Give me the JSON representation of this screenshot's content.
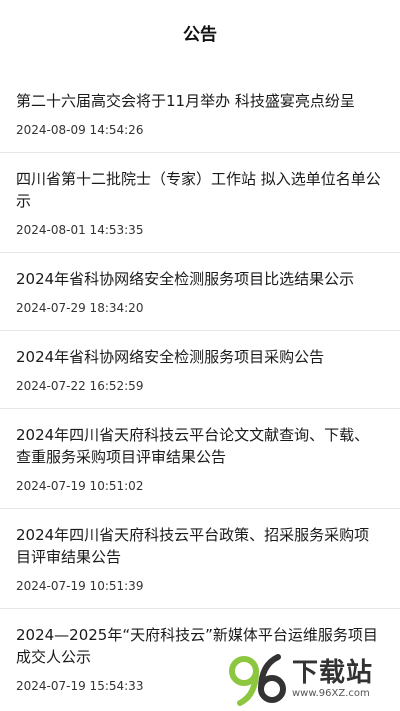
{
  "header": {
    "title": "公告"
  },
  "notices": [
    {
      "title": "第二十六届高交会将于11月举办 科技盛宴亮点纷呈",
      "date": "2024-08-09 14:54:26"
    },
    {
      "title": "四川省第十二批院士（专家）工作站  拟入选单位名单公示",
      "date": "2024-08-01 14:53:35"
    },
    {
      "title": "2024年省科协网络安全检测服务项目比选结果公示",
      "date": "2024-07-29 18:34:20"
    },
    {
      "title": "2024年省科协网络安全检测服务项目采购公告",
      "date": "2024-07-22 16:52:59"
    },
    {
      "title": "2024年四川省天府科技云平台论文文献查询、下载、查重服务采购项目评审结果公告",
      "date": "2024-07-19 10:51:02"
    },
    {
      "title": "2024年四川省天府科技云平台政策、招采服务采购项目评审结果公告",
      "date": "2024-07-19 10:51:39"
    },
    {
      "title": "2024—2025年“天府科技云”新媒体平台运维服务项目成交人公示",
      "date": "2024-07-19 15:54:33"
    }
  ],
  "watermark": {
    "name": "下载站",
    "url": "www.96XZ.com",
    "colors": {
      "green": "#8dc63f",
      "dark": "#333333"
    }
  }
}
